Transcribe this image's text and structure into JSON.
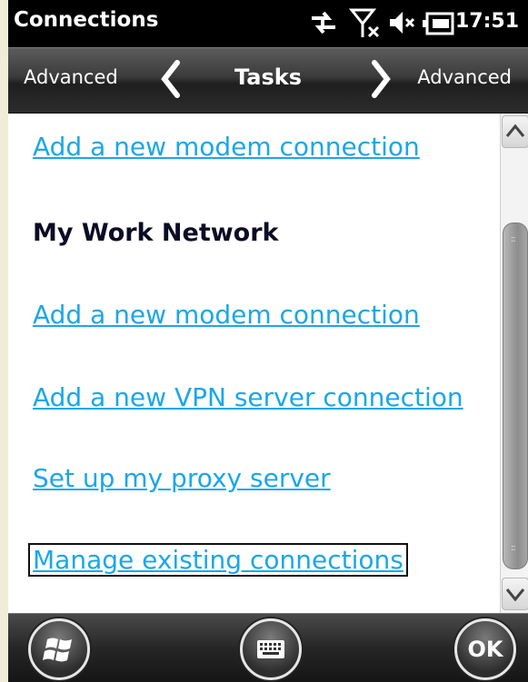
{
  "status_bar": {
    "title": "Connections",
    "time": "17:51",
    "icons": [
      "data-transfer-icon",
      "signal-no-service-icon",
      "speaker-muted-icon",
      "battery-charging-icon"
    ]
  },
  "nav_bar": {
    "left_label": "Advanced",
    "center_label": "Tasks",
    "right_label": "Advanced"
  },
  "content": {
    "items": [
      {
        "type": "link",
        "text": "Add a new modem connection"
      },
      {
        "type": "heading",
        "text": "My Work Network"
      },
      {
        "type": "link",
        "text": "Add a new modem connection"
      },
      {
        "type": "link",
        "text": "Add a new VPN server connection"
      },
      {
        "type": "link",
        "text": "Set up my proxy server"
      },
      {
        "type": "link",
        "text": "Manage existing connections",
        "focused": true
      }
    ]
  },
  "bottom_bar": {
    "ok_label": "OK"
  },
  "colors": {
    "link": "#1aa7e8",
    "heading": "#0c0c24",
    "bar_dark": "#000000"
  }
}
